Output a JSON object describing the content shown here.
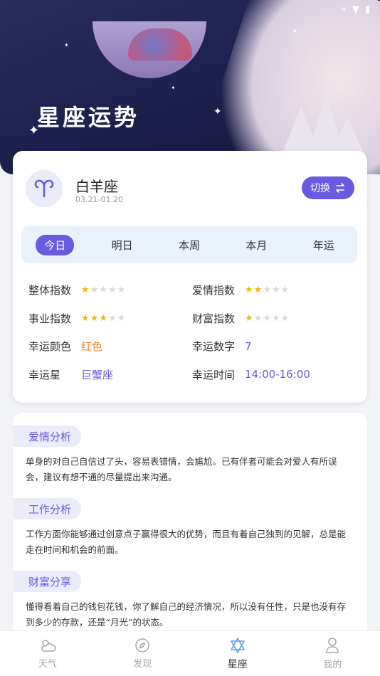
{
  "header": {
    "title": "星座运势"
  },
  "sign": {
    "name": "白羊座",
    "date_range": "03.21-01.20",
    "switch_label": "切换"
  },
  "tabs": [
    {
      "label": "今日",
      "active": true
    },
    {
      "label": "明日",
      "active": false
    },
    {
      "label": "本周",
      "active": false
    },
    {
      "label": "本月",
      "active": false
    },
    {
      "label": "年运",
      "active": false
    }
  ],
  "indices": {
    "overall": {
      "label": "整体指数",
      "rating": 1,
      "max": 5
    },
    "love": {
      "label": "爱情指数",
      "rating": 2,
      "max": 5
    },
    "career": {
      "label": "事业指数",
      "rating": 3,
      "max": 5
    },
    "wealth": {
      "label": "财富指数",
      "rating": 1,
      "max": 5
    },
    "lucky_color": {
      "label": "幸运颜色",
      "value": "红色"
    },
    "lucky_number": {
      "label": "幸运数字",
      "value": "7"
    },
    "lucky_star": {
      "label": "幸运星",
      "value": "巨蟹座"
    },
    "lucky_time": {
      "label": "幸运时间",
      "value": "14:00-16:00"
    }
  },
  "sections": [
    {
      "title": "爱情分析",
      "text": "单身的对自己自信过了头，容易表错情，会尴尬。已有伴者可能会对爱人有所误会，建议有想不通的尽量提出来沟通。"
    },
    {
      "title": "工作分析",
      "text": "工作方面你能够通过创意点子赢得很大的优势，而且有着自己独到的见解，总是能走在时间和机会的前面。"
    },
    {
      "title": "财富分享",
      "text": "懂得看着自己的钱包花钱，你了解自己的经济情况，所以没有任性，只是也没有存到多少的存款，还是“月光”的状态。"
    }
  ],
  "nav": [
    {
      "label": "天气",
      "icon": "cloud-sun-icon",
      "active": false
    },
    {
      "label": "发现",
      "icon": "compass-icon",
      "active": false
    },
    {
      "label": "星座",
      "icon": "star-of-david-icon",
      "active": true
    },
    {
      "label": "我的",
      "icon": "person-icon",
      "active": false
    }
  ],
  "colors": {
    "accent": "#6a5ae0",
    "star_filled": "#f5b800",
    "star_empty": "#d9d9d9",
    "value_orange": "#f08a24",
    "value_purple": "#6a5ae0"
  }
}
